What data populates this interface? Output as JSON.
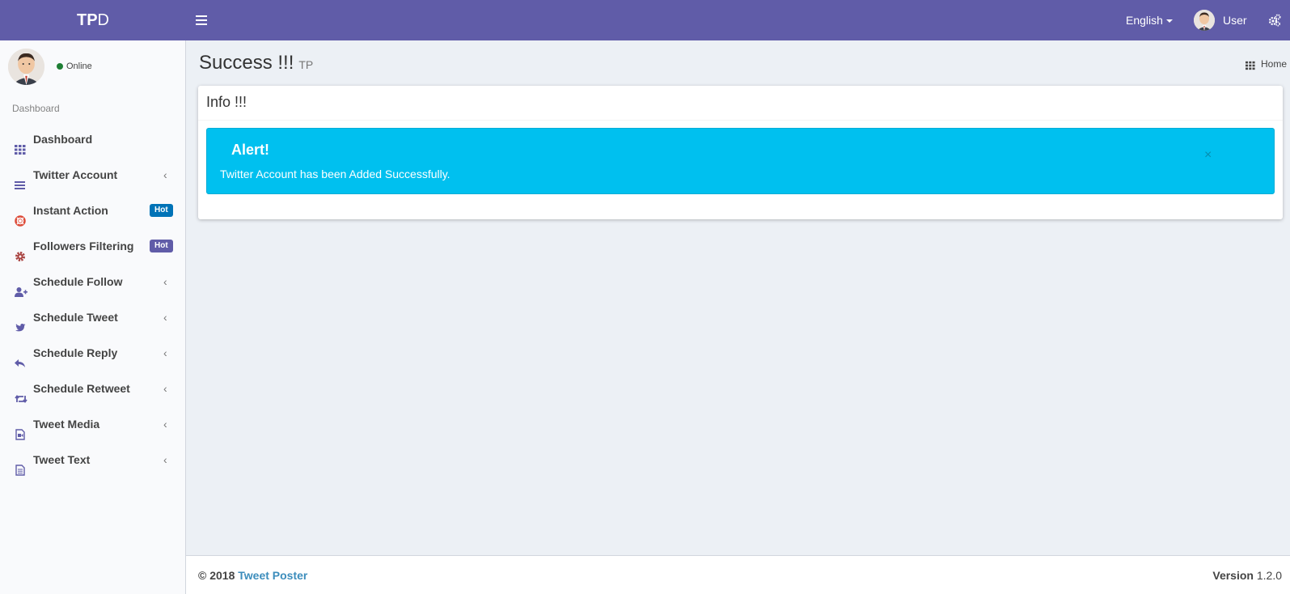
{
  "header": {
    "logo_bold": "TP",
    "logo_light": "D",
    "language": "English",
    "user_name": "User"
  },
  "sidebar": {
    "status": "Online",
    "section_header": "Dashboard",
    "items": [
      {
        "label": "Dashboard",
        "icon": "grid-icon"
      },
      {
        "label": "Twitter Account",
        "icon": "bars-icon",
        "has_submenu": true
      },
      {
        "label": "Instant Action",
        "icon": "lifebuoy-icon",
        "badge": "Hot"
      },
      {
        "label": "Followers Filtering",
        "icon": "gear-icon",
        "badge": "Hot"
      },
      {
        "label": "Schedule Follow",
        "icon": "user-plus-icon",
        "has_submenu": true
      },
      {
        "label": "Schedule Tweet",
        "icon": "twitter-bird-icon",
        "has_submenu": true
      },
      {
        "label": "Schedule Reply",
        "icon": "reply-icon",
        "has_submenu": true
      },
      {
        "label": "Schedule Retweet",
        "icon": "retweet-icon",
        "has_submenu": true
      },
      {
        "label": "Tweet Media",
        "icon": "file-media-icon",
        "has_submenu": true
      },
      {
        "label": "Tweet Text",
        "icon": "file-text-icon",
        "has_submenu": true
      }
    ],
    "colors": {
      "icon": "#605ca8",
      "instant_icon": "#dd4b39",
      "filter_icon": "#a94442",
      "badge_instant": "#0073b7",
      "badge_filter": "#605ca8"
    }
  },
  "content": {
    "title": "Success !!!",
    "subtitle": "TP",
    "breadcrumb": "Home",
    "box_title": "Info !!!",
    "alert_title": "Alert!",
    "alert_message": "Twitter Account has been Added Successfully.",
    "close_symbol": "×"
  },
  "footer": {
    "copyright": "© 2018",
    "brand": "Tweet Poster",
    "version_label": "Version",
    "version_number": "1.2.0"
  },
  "colors": {
    "header": "#605ca8",
    "alert": "#00c0ef",
    "link": "#3c8dbc"
  }
}
